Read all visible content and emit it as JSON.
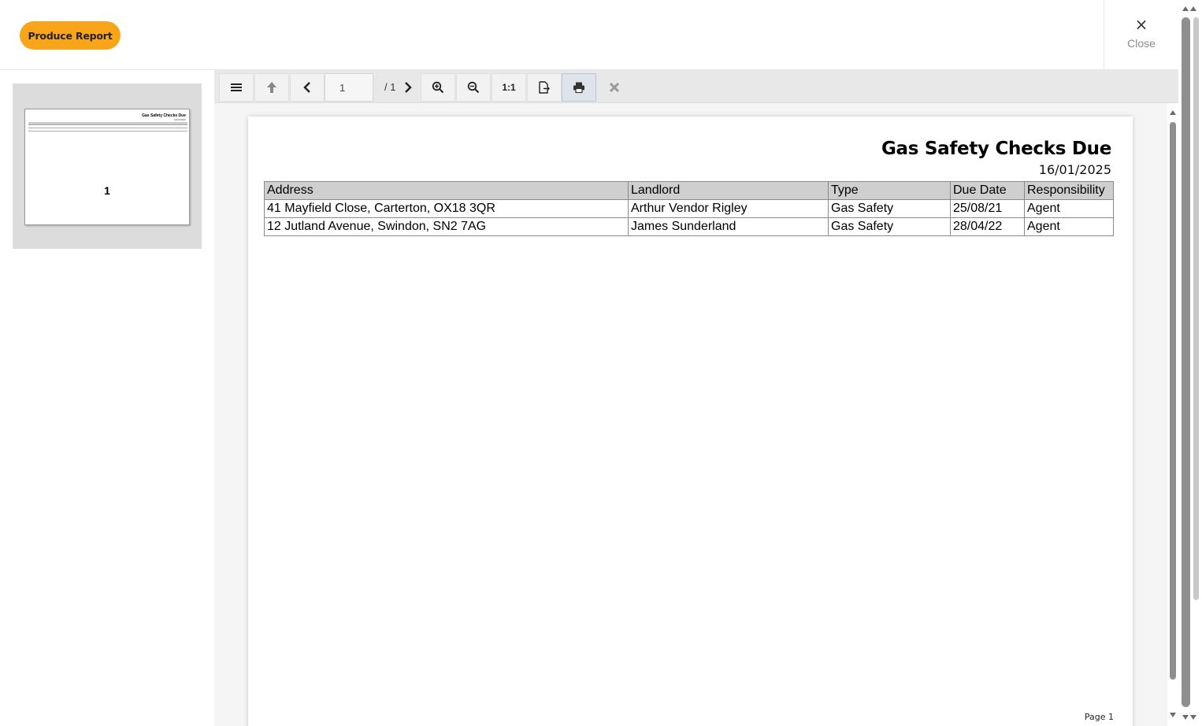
{
  "header": {
    "produce_report_label": "Produce Report",
    "close_icon": "×",
    "close_label": "Close"
  },
  "thumbnail": {
    "title": "Gas Safety Checks Due",
    "date": "16/01/2025",
    "page_number": "1"
  },
  "toolbar": {
    "page_input_value": "1",
    "page_total": "/ 1",
    "zoom_actual_label": "1:1",
    "icons": [
      "menu-icon",
      "arrow-up-icon",
      "chevron-left-icon",
      "chevron-right-icon",
      "zoom-in-icon",
      "zoom-out-icon",
      "export-icon",
      "print-icon",
      "close-icon"
    ]
  },
  "report": {
    "title": "Gas Safety Checks Due",
    "date": "16/01/2025",
    "columns": [
      "Address",
      "Landlord",
      "Type",
      "Due Date",
      "Responsibility"
    ],
    "rows": [
      [
        "41 Mayfield Close, Carterton, OX18 3QR",
        "Arthur Vendor Rigley",
        "Gas Safety",
        "25/08/21",
        "Agent"
      ],
      [
        "12 Jutland Avenue, Swindon, SN2 7AG",
        "James Sunderland",
        "Gas Safety",
        "28/04/22",
        "Agent"
      ]
    ],
    "footer": "Page 1"
  },
  "colors": {
    "accent": "#f9a51a",
    "header_row": "#cfcfcf"
  }
}
